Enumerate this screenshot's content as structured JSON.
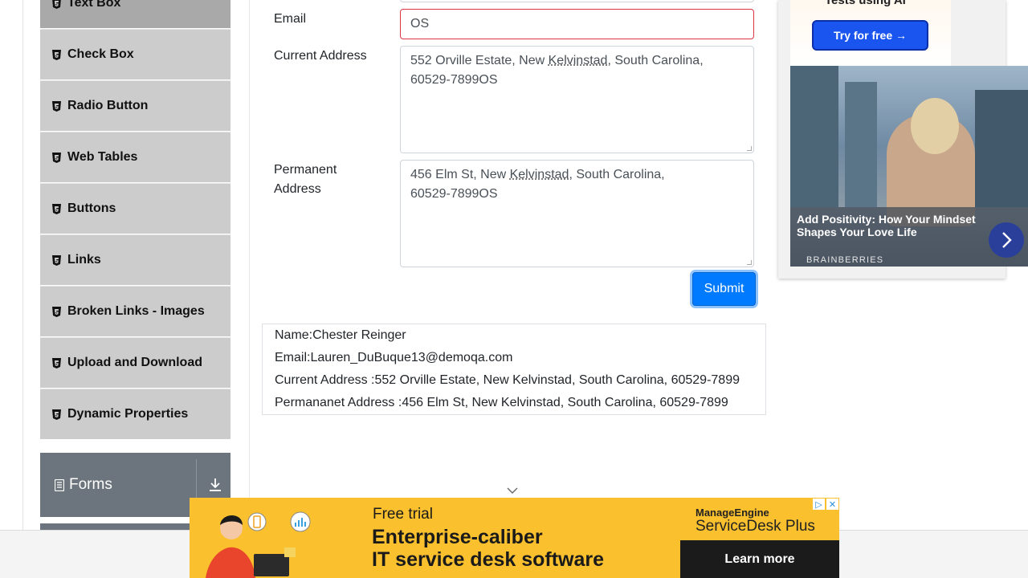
{
  "sidebar": {
    "items": [
      {
        "label": "Text Box",
        "active": true
      },
      {
        "label": "Check Box"
      },
      {
        "label": "Radio Button"
      },
      {
        "label": "Web Tables"
      },
      {
        "label": "Buttons"
      },
      {
        "label": "Links"
      },
      {
        "label": "Broken Links - Images"
      },
      {
        "label": "Upload and Download"
      },
      {
        "label": "Dynamic Properties"
      }
    ],
    "groups": [
      {
        "label": "Forms",
        "icon": "document-icon"
      }
    ]
  },
  "form": {
    "email": {
      "label": "Email",
      "value": "OS",
      "state": "error"
    },
    "current_address": {
      "label": "Current Address",
      "line1_pre": "552 Orville Estate, New ",
      "line1_word": "Kelvinstad",
      "line1_post": ", South Carolina,",
      "line2": "60529-7899OS"
    },
    "permanent_address": {
      "label_line1": "Permanent",
      "label_line2": "Address",
      "line1_pre": "456 Elm St, New ",
      "line1_word": "Kelvinstad",
      "line1_post": ", South Carolina,",
      "line2": "60529-7899OS"
    },
    "submit_label": "Submit"
  },
  "output": {
    "name": "Name:Chester Reinger",
    "email": "Email:Lauren_DuBuque13@demoqa.com",
    "current_address": "Current Address :552 Orville Estate, New Kelvinstad, South Carolina, 60529-7899",
    "permanent_address": "Permananet Address :456 Elm St, New Kelvinstad, South Carolina, 60529-7899"
  },
  "ads": {
    "right": {
      "tagline": "Tests using AI",
      "button": "Try for free →",
      "caption": "Add Positivity: How Your Mindset Shapes Your Love Life",
      "source": "BRAINBERRIES"
    },
    "bottom": {
      "line1": "Free trial",
      "line2": "Enterprise-caliber",
      "line3": "IT service desk software",
      "brand1": "ManageEngine",
      "brand2": "ServiceDesk Plus",
      "cta": "Learn more"
    }
  },
  "colors": {
    "accent": "#007bff",
    "error": "#dc3545",
    "sidebar_item": "#cccccc",
    "sidebar_group": "#6c757d",
    "ad_yellow": "#fbc02d"
  }
}
